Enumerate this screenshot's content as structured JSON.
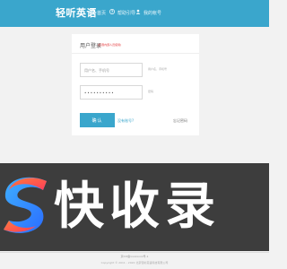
{
  "header": {
    "brand": "轻听英语",
    "nav": [
      {
        "label": "首页",
        "icon": "phone-icon"
      },
      {
        "label": "帮助引导",
        "icon": "help-circle-icon"
      },
      {
        "label": "我的帐号",
        "icon": "user-icon"
      }
    ]
  },
  "login": {
    "title": "用户登录",
    "note": "(仅限内部人员使用)",
    "username_placeholder": "用户名、手机号",
    "username_hint": "用户名、手机号",
    "password_value": "••••••••••",
    "password_hint": "密码",
    "submit_label": "确认",
    "register_link": "没有账号?",
    "forgot_link": "忘记密码"
  },
  "watermark": {
    "text": "快收录"
  },
  "footer": {
    "license": "京ICP备xxxxxxxx号-1",
    "copyright": "Copyright © 2011 - 2022 北京轻听英语科技有限公司"
  },
  "colors": {
    "accent": "#3aa6cc",
    "watermark_bg": "#3d3d3d"
  }
}
